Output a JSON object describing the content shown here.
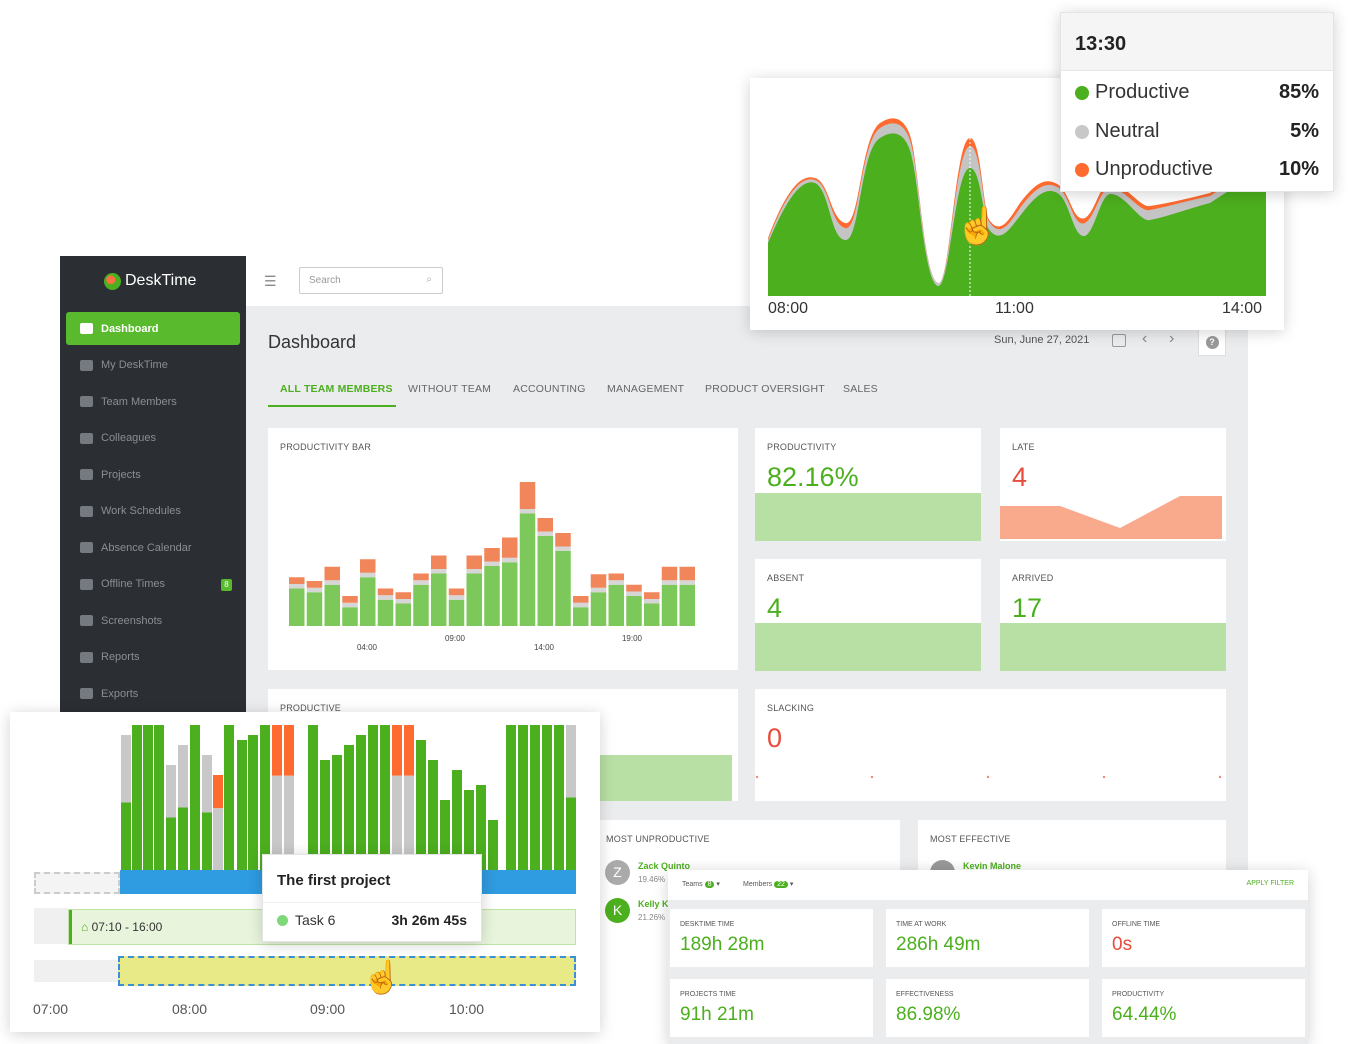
{
  "app": {
    "name": "DeskTime"
  },
  "sidebar": {
    "items": [
      {
        "label": "Dashboard",
        "icon": "bar-chart-icon",
        "active": true
      },
      {
        "label": "My DeskTime",
        "icon": "monitor-icon"
      },
      {
        "label": "Team Members",
        "icon": "users-icon"
      },
      {
        "label": "Colleagues",
        "icon": "user-circle-icon"
      },
      {
        "label": "Projects",
        "icon": "image-icon"
      },
      {
        "label": "Work Schedules",
        "icon": "briefcase-icon"
      },
      {
        "label": "Absence Calendar",
        "icon": "calendar-icon"
      },
      {
        "label": "Offline Times",
        "icon": "clock-icon",
        "badge": "8"
      },
      {
        "label": "Screenshots",
        "icon": "screenshot-icon"
      },
      {
        "label": "Reports",
        "icon": "pie-chart-icon"
      },
      {
        "label": "Exports",
        "icon": "export-icon"
      }
    ]
  },
  "search": {
    "placeholder": "Search"
  },
  "page": {
    "title": "Dashboard",
    "date": "Sun, June 27, 2021",
    "help": "?"
  },
  "tabs": [
    "ALL TEAM MEMBERS",
    "WITHOUT TEAM",
    "ACCOUNTING",
    "MANAGEMENT",
    "PRODUCT OVERSIGHT",
    "SALES"
  ],
  "cards": {
    "productivity_bar": {
      "label": "PRODUCTIVITY BAR"
    },
    "productivity": {
      "label": "PRODUCTIVITY",
      "value": "82.16%"
    },
    "late": {
      "label": "LATE",
      "value": "4"
    },
    "absent": {
      "label": "ABSENT",
      "value": "4"
    },
    "arrived": {
      "label": "ARRIVED",
      "value": "17"
    },
    "productive": {
      "label": "PRODUCTIVE"
    },
    "slacking": {
      "label": "SLACKING",
      "value": "0"
    },
    "most_unproductive": {
      "label": "MOST UNPRODUCTIVE",
      "people": [
        {
          "initial": "Z",
          "name": "Zack Quinto",
          "pct": "19.46%"
        },
        {
          "initial": "K",
          "name": "Kelly Ka",
          "pct": "21.26%"
        }
      ]
    },
    "most_effective": {
      "label": "MOST EFFECTIVE",
      "people": [
        {
          "initial": "K",
          "name": "Kevin Malone"
        }
      ]
    }
  },
  "chart_data": [
    {
      "type": "bar",
      "title": "PRODUCTIVITY BAR",
      "x_tick_labels": [
        "04:00",
        "09:00",
        "14:00",
        "19:00"
      ],
      "series": [
        {
          "name": "Productive",
          "color": "#7dc85a",
          "values": [
            10,
            9,
            11,
            5,
            13,
            7,
            6,
            11,
            14,
            7,
            14,
            16,
            17,
            30,
            24,
            20,
            5,
            9,
            11,
            8,
            6,
            11,
            11
          ]
        },
        {
          "name": "Neutral",
          "color": "#d6d6d6",
          "values": [
            1,
            1,
            1,
            1,
            1,
            1,
            1,
            1,
            1,
            1,
            1,
            1,
            1,
            1,
            1,
            1,
            1,
            1,
            1,
            1,
            1,
            1,
            1
          ]
        },
        {
          "name": "Unproductive",
          "color": "#f0865a",
          "values": [
            1,
            1,
            2,
            1,
            2,
            1,
            1,
            1,
            2,
            1,
            2,
            2,
            3,
            4,
            2,
            2,
            1,
            2,
            1,
            1,
            1,
            2,
            2
          ]
        }
      ]
    },
    {
      "type": "area",
      "x_tick_labels": [
        "08:00",
        "11:00",
        "14:00"
      ],
      "tooltip": {
        "time": "13:30",
        "rows": [
          {
            "label": "Productive",
            "value": "85%",
            "color": "#4caf1e"
          },
          {
            "label": "Neutral",
            "value": "5%",
            "color": "#c8c8c8"
          },
          {
            "label": "Unproductive",
            "value": "10%",
            "color": "#ff6a2f"
          }
        ]
      }
    },
    {
      "type": "bar",
      "x_tick_labels": [
        "07:00",
        "08:00",
        "09:00",
        "10:00"
      ]
    }
  ],
  "timeline": {
    "schedule": "07:10 - 16:00",
    "tooltip": {
      "title": "The first project",
      "task": "Task 6",
      "duration": "3h 26m 45s"
    }
  },
  "stats_panel": {
    "teams_label": "Teams",
    "teams_count": "8",
    "members_label": "Members",
    "members_count": "22",
    "apply_filter": "APPLY FILTER",
    "items": [
      {
        "label": "DESKTIME TIME",
        "value": "189h 28m"
      },
      {
        "label": "TIME AT WORK",
        "value": "286h 49m"
      },
      {
        "label": "OFFLINE TIME",
        "value": "0s"
      },
      {
        "label": "PROJECTS TIME",
        "value": "91h 21m"
      },
      {
        "label": "EFFECTIVENESS",
        "value": "86.98%"
      },
      {
        "label": "PRODUCTIVITY",
        "value": "64.44%"
      }
    ]
  }
}
